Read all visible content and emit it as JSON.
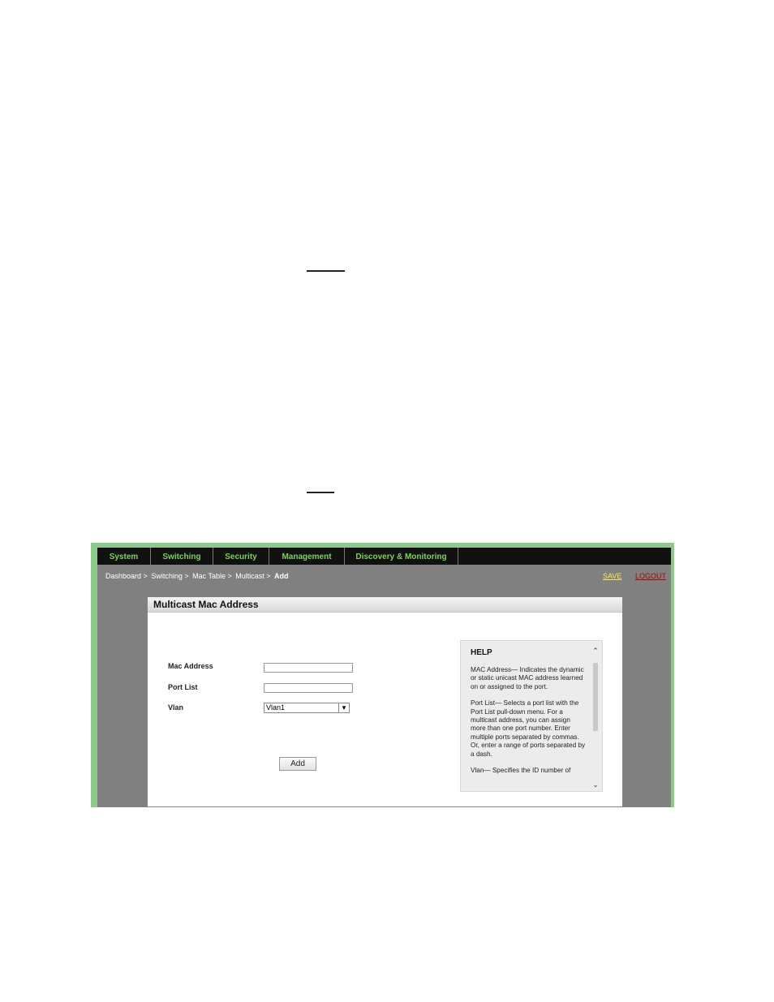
{
  "nav": {
    "items": [
      {
        "label": "System"
      },
      {
        "label": "Switching"
      },
      {
        "label": "Security"
      },
      {
        "label": "Management"
      },
      {
        "label": "Discovery & Monitoring"
      }
    ]
  },
  "breadcrumb": {
    "items": [
      "Dashboard >",
      "Switching >",
      "Mac Table >",
      "Multicast >"
    ],
    "current": "Add"
  },
  "header_links": {
    "save": "SAVE",
    "logout": "LOGOUT"
  },
  "panel": {
    "title": "Multicast Mac Address",
    "form": {
      "mac_label": "Mac Address",
      "mac_value": "",
      "port_label": "Port List",
      "port_value": "",
      "vlan_label": "Vlan",
      "vlan_selected": "Vlan1",
      "add_label": "Add"
    }
  },
  "help": {
    "title": "HELP",
    "p1": "MAC Address— Indicates the dynamic or static unicast MAC address learned on or assigned to the port.",
    "p2": "Port List— Selects a port list with the Port List pull-down menu. For a multicast address, you can assign more than one port number. Enter multiple ports separated by commas. Or, enter a range of ports separated by a dash.",
    "p3": "Vlan— Specifies the ID number of"
  },
  "colors": {
    "nav_text": "#7dd35c",
    "save": "#ffe84a",
    "logout": "#b00000",
    "frame": "#8fc98a"
  }
}
